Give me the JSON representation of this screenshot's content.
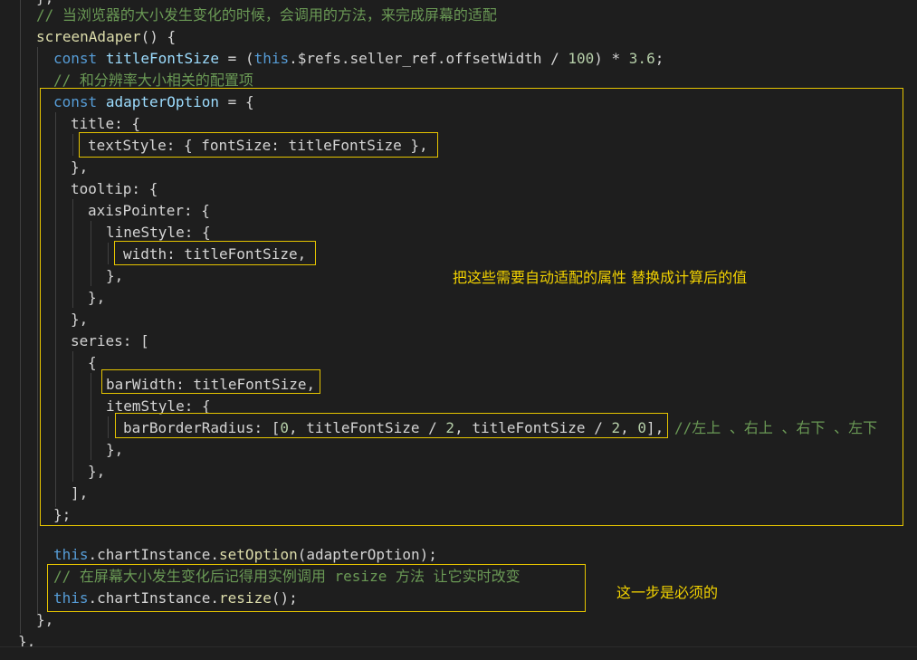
{
  "code": {
    "top_brace": "},",
    "comment_resize": "// 当浏览器的大小发生变化的时候，会调用的方法，来完成屏幕的适配",
    "fn_name": "screenAdaper",
    "fn_open": "() {",
    "const_kw": "const",
    "title_font_var": "titleFontSize",
    "assign": " = (",
    "this_kw": "this",
    "refs_expr": ".$refs.seller_ref.offsetWidth / ",
    "num_100": "100",
    "mul": ") * ",
    "num_36": "3.6",
    "semicolon": ";",
    "comment_config": "// 和分辨率大小相关的配置项",
    "adapter_var": "adapterOption",
    "assign_open": " = {",
    "title_open": "title: {",
    "textstyle_line": "textStyle: { fontSize: titleFontSize },",
    "close_comma": "},",
    "tooltip_open": "tooltip: {",
    "axispointer_open": "axisPointer: {",
    "linestyle_open": "lineStyle: {",
    "width_line": "width: titleFontSize,",
    "series_open": "series: [",
    "open_brace": "{",
    "barwidth_line": "barWidth: titleFontSize,",
    "itemstyle_open": "itemStyle: {",
    "radius_prefix": "barBorderRadius: [",
    "zero": "0",
    "radius_mid1": ", titleFontSize / ",
    "two": "2",
    "radius_mid2": ", titleFontSize / ",
    "radius_mid3": ", ",
    "radius_suffix": "],",
    "radius_comment": "//左上 、右上 、右下 、左下",
    "bracket_close": "],",
    "obj_close": "};",
    "setoption_this": "this",
    "setoption_rest": ".chartInstance.",
    "setoption_fn": "setOption",
    "setoption_args": "(adapterOption);",
    "comment_resize_call": "// 在屏幕大小发生变化后记得用实例调用 resize 方法 让它实时改变",
    "resize_this": "this",
    "resize_rest": ".chartInstance.",
    "resize_fn": "resize",
    "resize_args": "();",
    "fn_close": "},",
    "outer_close": "},"
  },
  "annotations": {
    "replace_note": "把这些需要自动适配的属性 替换成计算后的值",
    "required_note": "这一步是必须的"
  },
  "colors": {
    "background": "#1e1e1e",
    "highlight_box": "#e5c400",
    "annotation_text": "#f2d200",
    "comment": "#6a9955",
    "keyword": "#569cd6",
    "variable": "#9cdcfe",
    "function": "#dcdcaa",
    "number": "#b5cea8"
  }
}
